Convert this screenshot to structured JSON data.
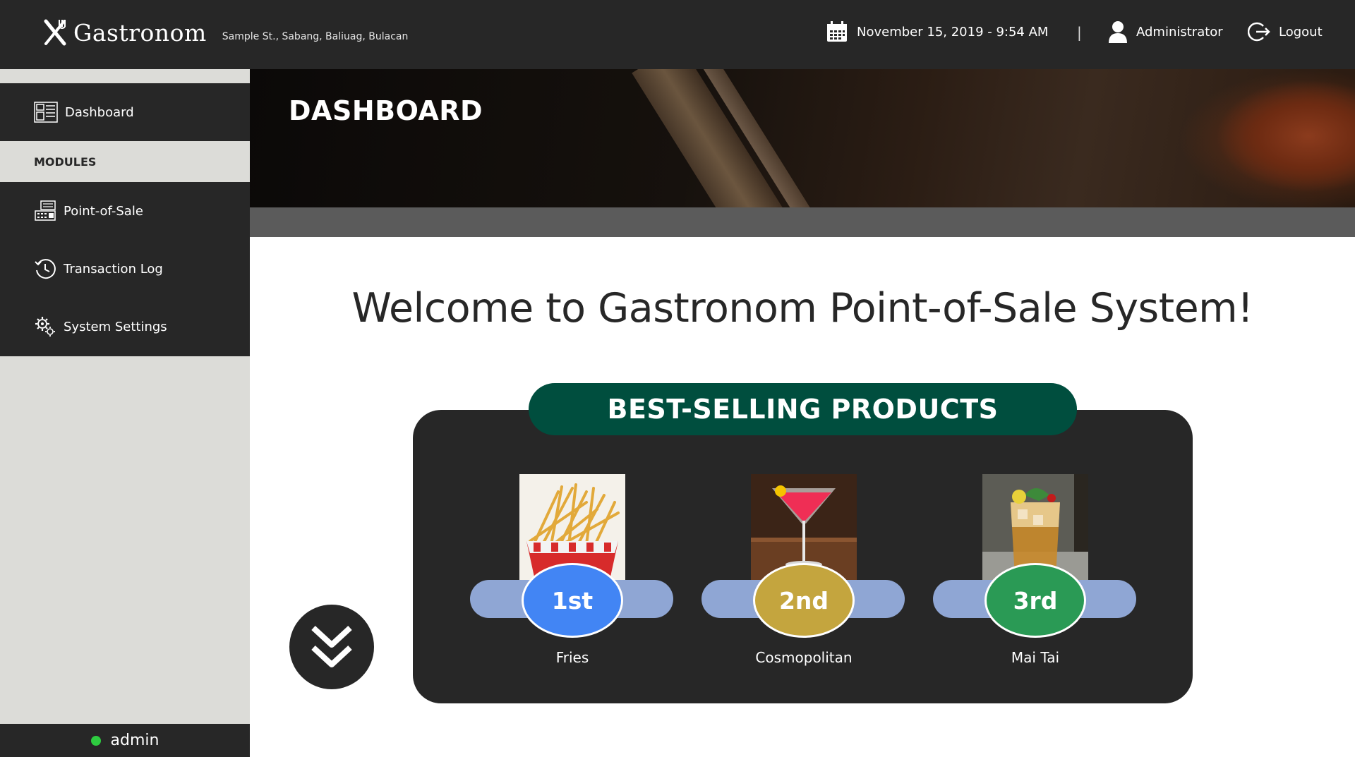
{
  "header": {
    "brand": "Gastronom",
    "address": "Sample St., Sabang, Baliuag, Bulacan",
    "datetime": "November 15, 2019 - 9:54 AM",
    "separator": "|",
    "user_label": "Administrator",
    "logout_label": "Logout"
  },
  "sidebar": {
    "dashboard_label": "Dashboard",
    "section_label": "MODULES",
    "items": [
      {
        "label": "Point-of-Sale",
        "icon": "pos-terminal-icon"
      },
      {
        "label": "Transaction Log",
        "icon": "clock-history-icon"
      },
      {
        "label": "System Settings",
        "icon": "gears-icon"
      }
    ],
    "current_user": "admin",
    "status_color": "#2ecc40"
  },
  "banner": {
    "title": "DASHBOARD"
  },
  "main": {
    "welcome": "Welcome to Gastronom Point-of-Sale System!",
    "best_selling_title": "BEST-SELLING PRODUCTS",
    "products": [
      {
        "rank": "1st",
        "name": "Fries",
        "medal_color": "#4285f4"
      },
      {
        "rank": "2nd",
        "name": "Cosmopolitan",
        "medal_color": "#c4a53e"
      },
      {
        "rank": "3rd",
        "name": "Mai Tai",
        "medal_color": "#2a9a55"
      }
    ]
  },
  "colors": {
    "dark": "#272727",
    "sidebar_bg": "#dcdcd8",
    "title_green": "#004e3e",
    "bar_blue": "#8fa6d4"
  }
}
